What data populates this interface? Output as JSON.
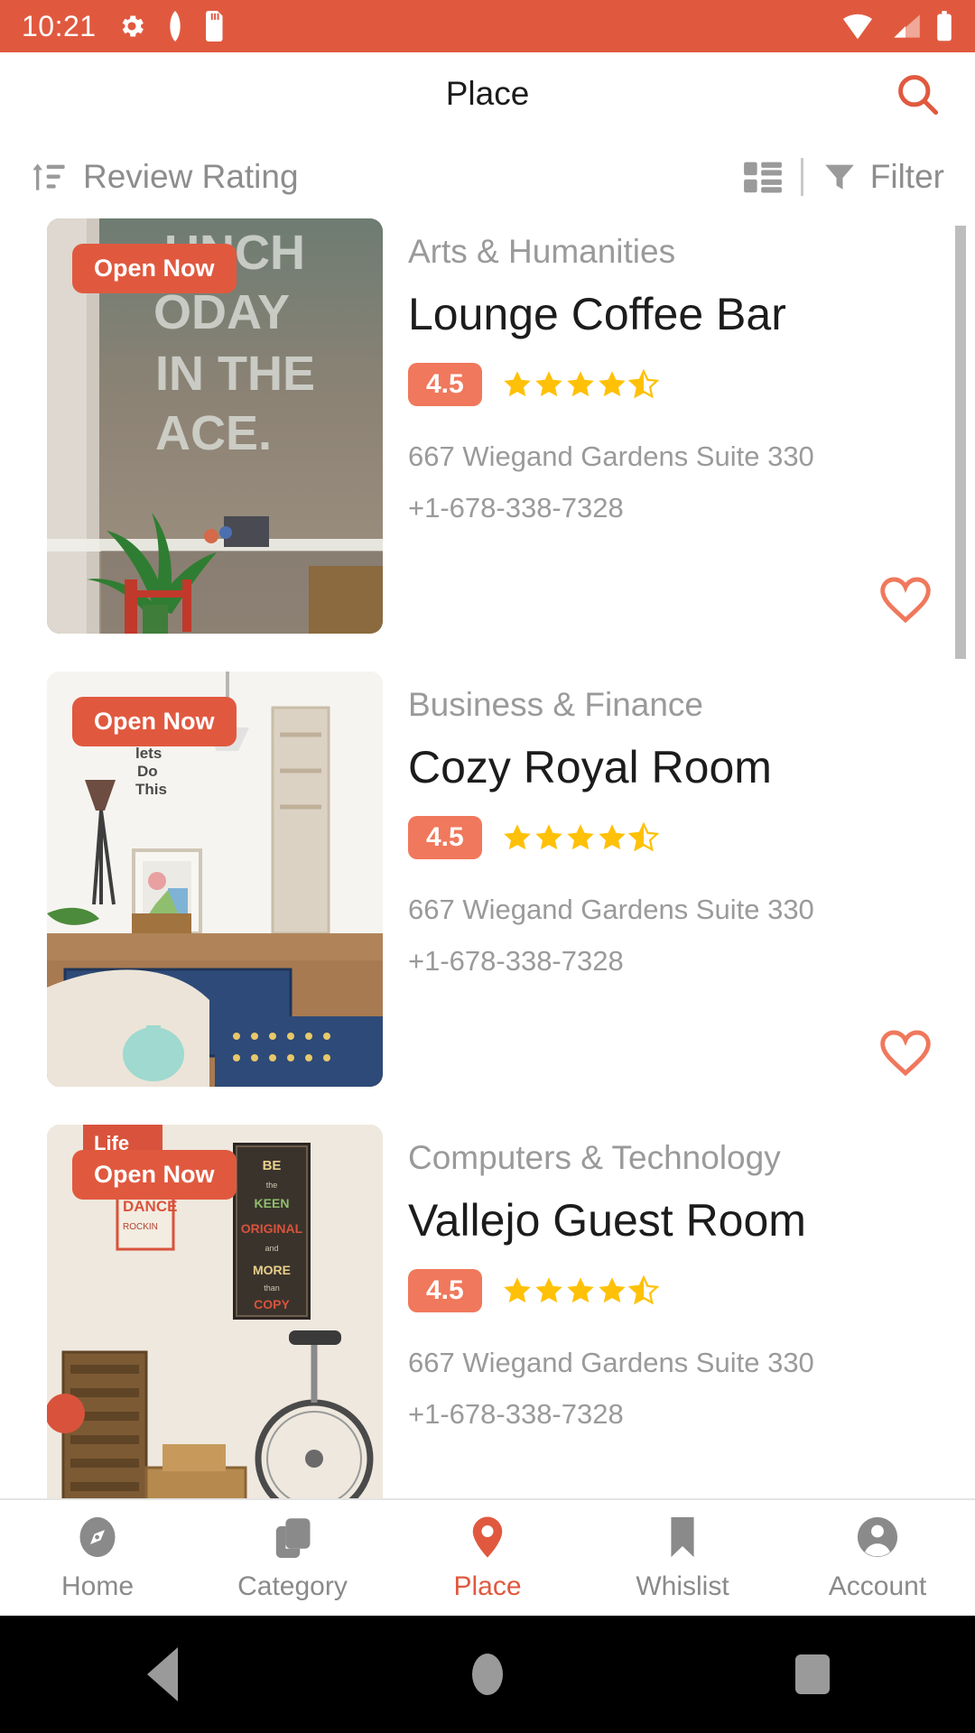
{
  "status_bar": {
    "time": "10:21",
    "left_icons": [
      "gear-icon",
      "shield-icon",
      "sd-card-icon"
    ],
    "right_icons": [
      "wifi-icon",
      "cellular-signal-icon",
      "battery-icon"
    ],
    "background_color": "#e0593f"
  },
  "app_bar": {
    "title": "Place",
    "search_icon": "search-icon"
  },
  "sort_bar": {
    "sort_icon": "sort-ascending-icon",
    "sort_label": "Review Rating",
    "view_toggle_icon": "list-view-icon",
    "filter_icon": "filter-funnel-icon",
    "filter_label": "Filter"
  },
  "theme": {
    "accent": "#e0593f",
    "badge_orange": "#f0785c",
    "star_gold": "#ffc107",
    "muted_text": "#9a9a9a",
    "title_text": "#1c1c1c"
  },
  "places": [
    {
      "open_badge": "Open Now",
      "category": "Arts & Humanities",
      "name": "Lounge Coffee Bar",
      "rating": "4.5",
      "stars_filled": 4,
      "stars_half": 1,
      "address": "667 Wiegand Gardens Suite 330",
      "phone": "+1-678-338-7328",
      "favorite_icon": "heart-outline-icon",
      "image_alt": "wall-mural-punch-today-in-the-face-with-plant"
    },
    {
      "open_badge": "Open Now",
      "category": "Business & Finance",
      "name": "Cozy Royal Room",
      "rating": "4.5",
      "stars_filled": 4,
      "stars_half": 1,
      "address": "667 Wiegand Gardens Suite 330",
      "phone": "+1-678-338-7328",
      "favorite_icon": "heart-outline-icon",
      "image_alt": "bedroom-with-lamp-framed-art-and-blue-rug"
    },
    {
      "open_badge": "Open Now",
      "category": "Computers & Technology",
      "name": "Vallejo Guest Room",
      "rating": "4.5",
      "stars_filled": 4,
      "stars_half": 1,
      "address": "667 Wiegand Gardens Suite 330",
      "phone": "+1-678-338-7328",
      "favorite_icon": "heart-outline-icon",
      "image_alt": "room-with-posters-unicycle-and-wooden-crate"
    }
  ],
  "bottom_nav": [
    {
      "label": "Home",
      "icon": "compass-icon",
      "active": false
    },
    {
      "label": "Category",
      "icon": "layers-icon",
      "active": false
    },
    {
      "label": "Place",
      "icon": "map-pin-icon",
      "active": true
    },
    {
      "label": "Whislist",
      "icon": "bookmark-icon",
      "active": false
    },
    {
      "label": "Account",
      "icon": "person-icon",
      "active": false
    }
  ],
  "android_nav": {
    "back": "back-triangle-icon",
    "home": "home-circle-icon",
    "recents": "recents-square-icon"
  }
}
